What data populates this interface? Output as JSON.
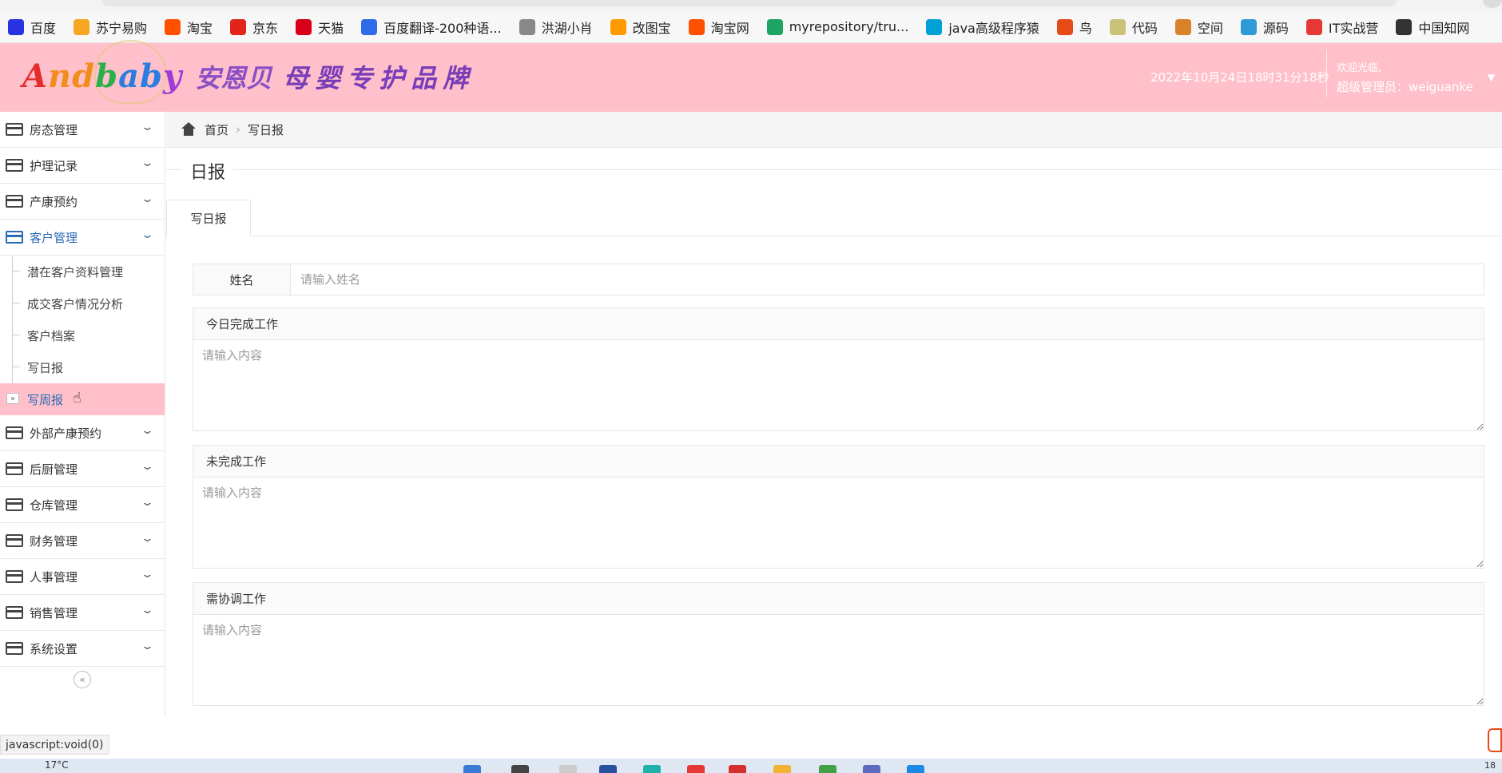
{
  "bookmarks": [
    {
      "label": "百度",
      "icon": "baidu-paw-icon",
      "color": "#2932e1"
    },
    {
      "label": "苏宁易购",
      "icon": "suning-icon",
      "color": "#f5a623"
    },
    {
      "label": "淘宝",
      "icon": "taobao-icon",
      "color": "#ff5000"
    },
    {
      "label": "京东",
      "icon": "jd-icon",
      "color": "#e1251b"
    },
    {
      "label": "天猫",
      "icon": "tmall-icon",
      "color": "#d70018"
    },
    {
      "label": "百度翻译-200种语...",
      "icon": "baidu-translate-icon",
      "color": "#2e6be6"
    },
    {
      "label": "洪湖小肖",
      "icon": "fish-icon",
      "color": "#888888"
    },
    {
      "label": "改图宝",
      "icon": "gaitubao-icon",
      "color": "#ff9a00"
    },
    {
      "label": "淘宝网",
      "icon": "taobao-net-icon",
      "color": "#ff5000"
    },
    {
      "label": "myrepository/tru...",
      "icon": "chrome-icon",
      "color": "#1da462"
    },
    {
      "label": "java高级程序猿",
      "icon": "bilibili-icon",
      "color": "#00a1d6"
    },
    {
      "label": "鸟",
      "icon": "bird-icon",
      "color": "#e64a19"
    },
    {
      "label": "代码",
      "icon": "code-icon",
      "color": "#c9c27a"
    },
    {
      "label": "空间",
      "icon": "qzone-icon",
      "color": "#d9822b"
    },
    {
      "label": "源码",
      "icon": "source-icon",
      "color": "#2f9bd6"
    },
    {
      "label": "IT实战营",
      "icon": "it-icon",
      "color": "#e53935"
    },
    {
      "label": "中国知网",
      "icon": "cnki-icon",
      "color": "#333333"
    }
  ],
  "header": {
    "logo_en": [
      "A",
      "nd",
      "b",
      "ab",
      "y"
    ],
    "logo_cn": "安恩贝",
    "slogan": "母婴专护品牌",
    "datetime": "2022年10月24日18时31分18秒",
    "welcome": "欢迎光临,",
    "admin": "超级管理员：weiguanke",
    "bg_color": "#ffc0cb"
  },
  "sidebar": {
    "menus_top": [
      {
        "label": "房态管理"
      },
      {
        "label": "护理记录"
      },
      {
        "label": "产康预约"
      },
      {
        "label": "客户管理",
        "active": true
      }
    ],
    "submenu": [
      {
        "label": "潜在客户资料管理"
      },
      {
        "label": "成交客户情况分析"
      },
      {
        "label": "客户档案"
      },
      {
        "label": "写日报"
      },
      {
        "label": "写周报",
        "selected": true
      }
    ],
    "menus_bottom": [
      {
        "label": "外部产康预约"
      },
      {
        "label": "后厨管理"
      },
      {
        "label": "仓库管理"
      },
      {
        "label": "财务管理"
      },
      {
        "label": "人事管理"
      },
      {
        "label": "销售管理"
      },
      {
        "label": "系统设置"
      }
    ],
    "collapse_glyph": "«"
  },
  "breadcrumb": {
    "home": "首页",
    "separator": "›",
    "current": "写日报"
  },
  "page": {
    "legend": "日报",
    "tab": "写日报",
    "name_label": "姓名",
    "name_placeholder": "请输入姓名",
    "blocks": [
      {
        "title": "今日完成工作",
        "placeholder": "请输入内容"
      },
      {
        "title": "未完成工作",
        "placeholder": "请输入内容"
      },
      {
        "title": "需协调工作",
        "placeholder": "请输入内容"
      }
    ]
  },
  "status_bar": {
    "link": "javascript:void(0)"
  },
  "taskbar": {
    "weather": "17°C",
    "time": "18"
  }
}
